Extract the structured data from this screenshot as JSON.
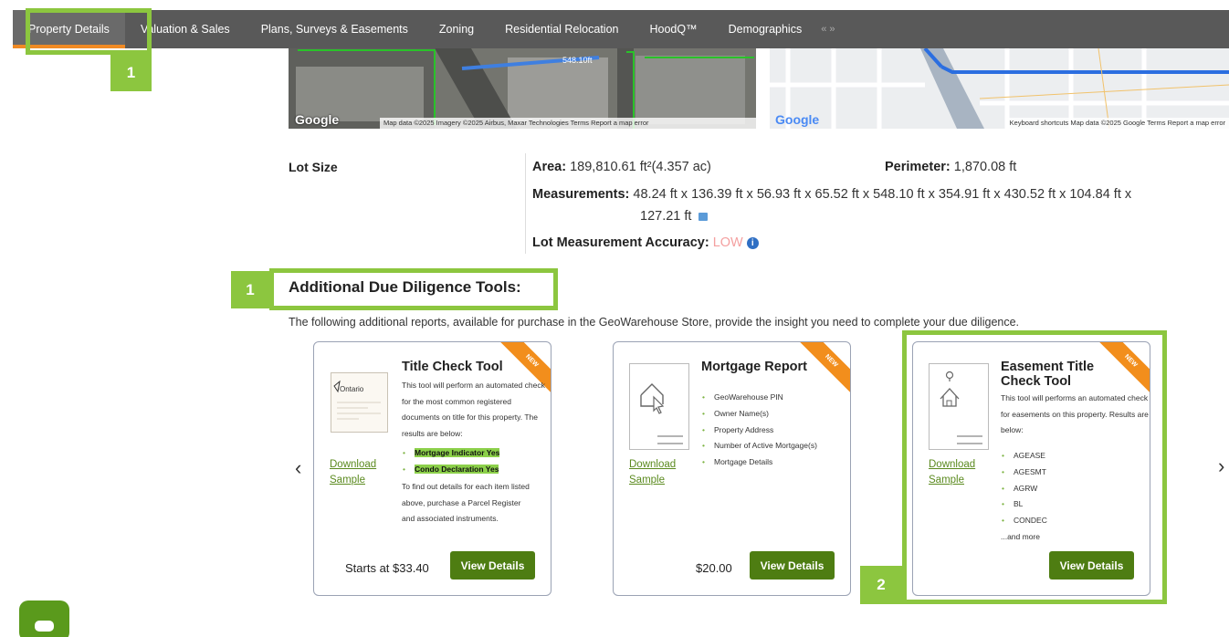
{
  "nav": {
    "tabs": [
      "Property Details",
      "Valuation & Sales",
      "Plans, Surveys & Easements",
      "Zoning",
      "Residential Relocation",
      "HoodQ™",
      "Demographics"
    ],
    "collapse_icon": "«»"
  },
  "badges": [
    "1",
    "1",
    "2"
  ],
  "maps": {
    "left_logo": "Google",
    "left_attr": "Map data ©2025 Imagery ©2025 Airbus, Maxar Technologies   Terms   Report a map error",
    "left_road_label": "548.10ft",
    "right_logo": "Google",
    "right_attr": "Keyboard shortcuts   Map data ©2025 Google   Terms   Report a map error"
  },
  "lot": {
    "label": "Lot Size",
    "area_label": "Area:",
    "area_value": "189,810.61 ft²(4.357 ac)",
    "perimeter_label": "Perimeter:",
    "perimeter_value": "1,870.08 ft",
    "measurements_label": "Measurements:",
    "measurements_line1": "48.24 ft x 136.39 ft x 56.93 ft x 65.52 ft x 548.10 ft x 354.91 ft x 430.52 ft x 104.84 ft x",
    "measurements_line2": "127.21 ft",
    "accuracy_label": "Lot Measurement Accuracy:",
    "accuracy_value": "LOW"
  },
  "tools": {
    "title": "Additional Due Diligence Tools:",
    "description": "The following additional reports, available for purchase in the GeoWarehouse Store, provide the insight you need to complete your due diligence."
  },
  "cards": [
    {
      "title": "Title Check Tool",
      "ribbon": "NEW",
      "thumb_label": "Ontario",
      "description": "This tool will perform an automated check for the most common registered documents on title for this property. The results are below:",
      "items": [
        "Mortgage Indicator Yes",
        "Condo Declaration Yes"
      ],
      "footer_note": "To find out details for each item listed above, purchase a Parcel Register and associated instruments.",
      "download_label": "Download Sample",
      "price": "Starts at $33.40",
      "button": "View Details"
    },
    {
      "title": "Mortgage Report",
      "ribbon": "NEW",
      "items": [
        "GeoWarehouse PIN",
        "Owner Name(s)",
        "Property Address",
        "Number of Active Mortgage(s)",
        "Mortgage Details"
      ],
      "download_label": "Download Sample",
      "price": "$20.00",
      "button": "View Details"
    },
    {
      "title": "Easement Title Check Tool",
      "ribbon": "NEW",
      "description": "This tool will performs an automated check for easements on this property. Results are below:",
      "items": [
        "AGEASE",
        "AGESMT",
        "AGRW",
        "BL",
        "CONDEC"
      ],
      "more": "...and more",
      "download_label": "Download Sample",
      "button": "View Details"
    }
  ],
  "carousel": {
    "prev": "‹",
    "next": "›"
  },
  "colors": {
    "accent_green": "#8cc63f",
    "button_green": "#4e7d12",
    "nav_bg": "#595959",
    "ribbon_orange": "#f28e1c",
    "active_tab_underline": "#f08a24"
  }
}
